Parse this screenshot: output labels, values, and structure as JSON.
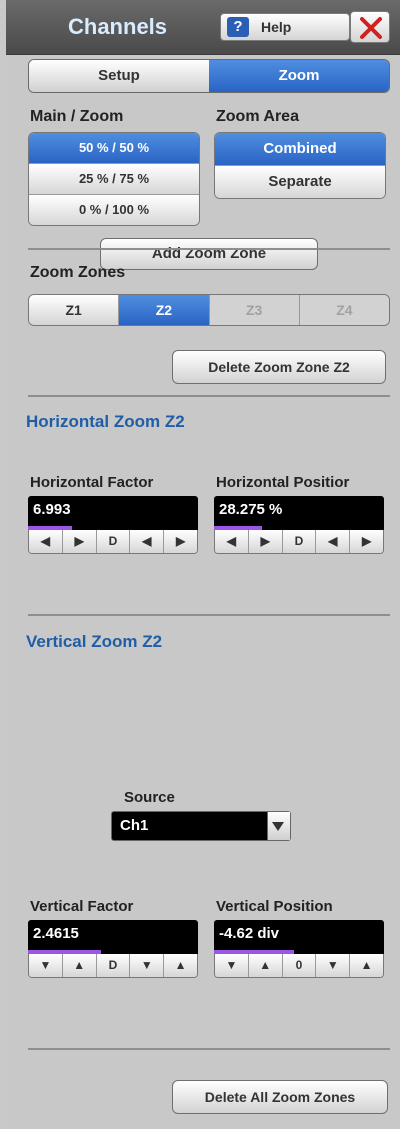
{
  "header": {
    "title": "Channels",
    "help_label": "Help",
    "help_icon": "question-icon",
    "close_icon": "close-x-icon"
  },
  "tabs": [
    {
      "label": "Setup",
      "active": false
    },
    {
      "label": "Zoom",
      "active": true
    }
  ],
  "main_zoom": {
    "label": "Main / Zoom",
    "options": [
      {
        "label": "50 % / 50 %",
        "selected": true
      },
      {
        "label": "25 % / 75 %",
        "selected": false
      },
      {
        "label": "0 % / 100 %",
        "selected": false
      }
    ]
  },
  "zoom_area": {
    "label": "Zoom Area",
    "options": [
      {
        "label": "Combined",
        "selected": true
      },
      {
        "label": "Separate",
        "selected": false
      }
    ]
  },
  "add_zoom_zone_label": "Add Zoom Zone",
  "zoom_zones": {
    "label": "Zoom Zones",
    "items": [
      {
        "label": "Z1",
        "state": "enabled"
      },
      {
        "label": "Z2",
        "state": "selected"
      },
      {
        "label": "Z3",
        "state": "disabled"
      },
      {
        "label": "Z4",
        "state": "disabled"
      }
    ]
  },
  "delete_zone_label": "Delete Zoom Zone Z2",
  "horizontal": {
    "title": "Horizontal Zoom Z2",
    "factor": {
      "label": "Horizontal Factor",
      "value": "6.993",
      "level": 0.26,
      "buttons": [
        "◀",
        "▶",
        "D",
        "◀",
        "▶"
      ]
    },
    "position": {
      "label": "Horizontal Positior",
      "value": "28.275 %",
      "level": 0.28,
      "buttons": [
        "◀",
        "▶",
        "D",
        "◀",
        "▶"
      ]
    }
  },
  "vertical": {
    "title": "Vertical Zoom Z2",
    "source_label": "Source",
    "source_value": "Ch1",
    "factor": {
      "label": "Vertical Factor",
      "value": "2.4615",
      "level": 0.43,
      "buttons": [
        "▼",
        "▲",
        "D",
        "▼",
        "▲"
      ]
    },
    "position": {
      "label": "Vertical Position",
      "value": "-4.62 div",
      "level": 0.47,
      "buttons": [
        "▼",
        "▲",
        "0",
        "▼",
        "▲"
      ]
    }
  },
  "delete_all_label": "Delete All Zoom Zones",
  "colors": {
    "accent": "#2a64c4",
    "section_title": "#1f5ea6",
    "level_bar": "#9d55e6"
  }
}
